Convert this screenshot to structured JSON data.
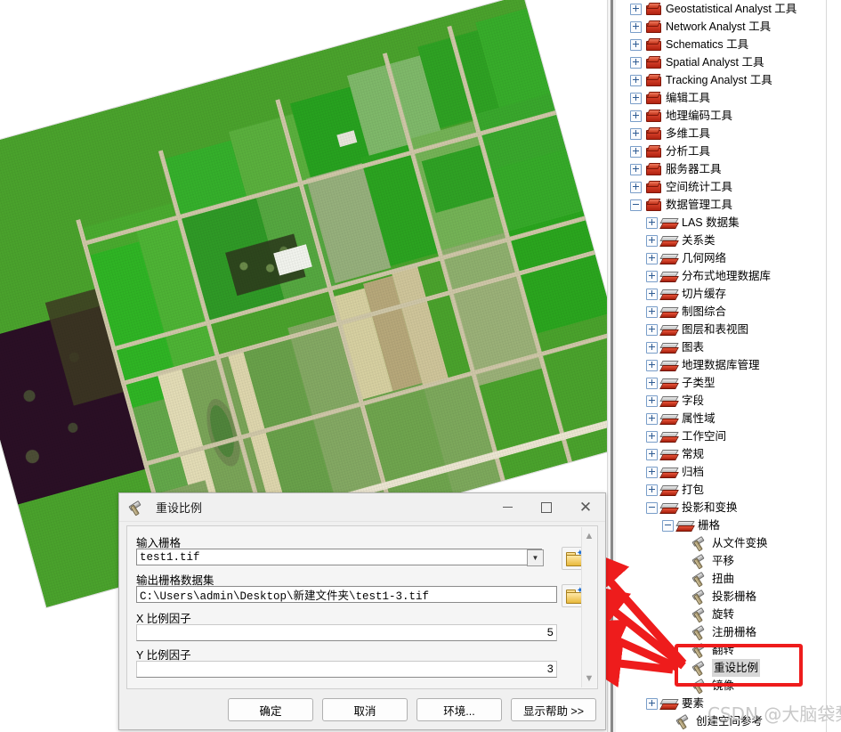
{
  "map": {
    "name": "aerial-raster-farmland",
    "rotation_deg": -15.5,
    "alt": "rotated aerial farmland raster"
  },
  "toolbox_tree": {
    "items": [
      {
        "label": "Geostatistical Analyst 工具",
        "level": 0,
        "icon": "toolbox-icon",
        "expander": "plus"
      },
      {
        "label": "Network Analyst 工具",
        "level": 0,
        "icon": "toolbox-icon",
        "expander": "plus"
      },
      {
        "label": "Schematics 工具",
        "level": 0,
        "icon": "toolbox-icon",
        "expander": "plus"
      },
      {
        "label": "Spatial Analyst 工具",
        "level": 0,
        "icon": "toolbox-icon",
        "expander": "plus"
      },
      {
        "label": "Tracking Analyst 工具",
        "level": 0,
        "icon": "toolbox-icon",
        "expander": "plus"
      },
      {
        "label": "编辑工具",
        "level": 0,
        "icon": "toolbox-icon",
        "expander": "plus"
      },
      {
        "label": "地理编码工具",
        "level": 0,
        "icon": "toolbox-icon",
        "expander": "plus"
      },
      {
        "label": "多维工具",
        "level": 0,
        "icon": "toolbox-icon",
        "expander": "plus"
      },
      {
        "label": "分析工具",
        "level": 0,
        "icon": "toolbox-icon",
        "expander": "plus"
      },
      {
        "label": "服务器工具",
        "level": 0,
        "icon": "toolbox-icon",
        "expander": "plus"
      },
      {
        "label": "空间统计工具",
        "level": 0,
        "icon": "toolbox-icon",
        "expander": "plus"
      },
      {
        "label": "数据管理工具",
        "level": 0,
        "icon": "toolbox-icon",
        "expander": "minus"
      },
      {
        "label": "LAS 数据集",
        "level": 1,
        "icon": "toolset-icon",
        "expander": "plus"
      },
      {
        "label": "关系类",
        "level": 1,
        "icon": "toolset-icon",
        "expander": "plus"
      },
      {
        "label": "几何网络",
        "level": 1,
        "icon": "toolset-icon",
        "expander": "plus"
      },
      {
        "label": "分布式地理数据库",
        "level": 1,
        "icon": "toolset-icon",
        "expander": "plus"
      },
      {
        "label": "切片缓存",
        "level": 1,
        "icon": "toolset-icon",
        "expander": "plus"
      },
      {
        "label": "制图综合",
        "level": 1,
        "icon": "toolset-icon",
        "expander": "plus"
      },
      {
        "label": "图层和表视图",
        "level": 1,
        "icon": "toolset-icon",
        "expander": "plus"
      },
      {
        "label": "图表",
        "level": 1,
        "icon": "toolset-icon",
        "expander": "plus"
      },
      {
        "label": "地理数据库管理",
        "level": 1,
        "icon": "toolset-icon",
        "expander": "plus"
      },
      {
        "label": "子类型",
        "level": 1,
        "icon": "toolset-icon",
        "expander": "plus"
      },
      {
        "label": "字段",
        "level": 1,
        "icon": "toolset-icon",
        "expander": "plus"
      },
      {
        "label": "属性域",
        "level": 1,
        "icon": "toolset-icon",
        "expander": "plus"
      },
      {
        "label": "工作空间",
        "level": 1,
        "icon": "toolset-icon",
        "expander": "plus"
      },
      {
        "label": "常规",
        "level": 1,
        "icon": "toolset-icon",
        "expander": "plus"
      },
      {
        "label": "归档",
        "level": 1,
        "icon": "toolset-icon",
        "expander": "plus"
      },
      {
        "label": "打包",
        "level": 1,
        "icon": "toolset-icon",
        "expander": "plus"
      },
      {
        "label": "投影和变换",
        "level": 1,
        "icon": "toolset-icon",
        "expander": "minus"
      },
      {
        "label": "栅格",
        "level": 2,
        "icon": "toolset-icon",
        "expander": "minus"
      },
      {
        "label": "从文件变换",
        "level": 3,
        "icon": "hammer-icon",
        "expander": "none"
      },
      {
        "label": "平移",
        "level": 3,
        "icon": "hammer-icon",
        "expander": "none"
      },
      {
        "label": "扭曲",
        "level": 3,
        "icon": "hammer-icon",
        "expander": "none"
      },
      {
        "label": "投影栅格",
        "level": 3,
        "icon": "hammer-icon",
        "expander": "none"
      },
      {
        "label": "旋转",
        "level": 3,
        "icon": "hammer-icon",
        "expander": "none"
      },
      {
        "label": "注册栅格",
        "level": 3,
        "icon": "hammer-icon",
        "expander": "none"
      },
      {
        "label": "翻转",
        "level": 3,
        "icon": "hammer-icon",
        "expander": "none"
      },
      {
        "label": "重设比例",
        "level": 3,
        "icon": "hammer-icon",
        "expander": "none",
        "selected": true
      },
      {
        "label": "镜像",
        "level": 3,
        "icon": "hammer-icon",
        "expander": "none"
      },
      {
        "label": "要素",
        "level": 1,
        "icon": "toolset-icon",
        "expander": "plus"
      },
      {
        "label": "创建空间参考",
        "level": 2,
        "icon": "hammer-icon",
        "expander": "none"
      }
    ],
    "highlight_color": "#ee1c1c"
  },
  "dialog": {
    "title": "重设比例",
    "title_icon": "hammer-icon",
    "window_buttons": {
      "minimize": "minimize-icon",
      "maximize": "maximize-icon",
      "close": "close-icon"
    },
    "fields": [
      {
        "label": "输入栅格",
        "value": "test1.tif",
        "control": "combobox",
        "browse_icon": "open-folder-icon"
      },
      {
        "label": "输出栅格数据集",
        "value": "C:\\Users\\admin\\Desktop\\新建文件夹\\test1-3.tif",
        "control": "textbox",
        "browse_icon": "open-folder-icon"
      },
      {
        "label": "X 比例因子",
        "value": "5",
        "control": "numberbox"
      },
      {
        "label": "Y 比例因子",
        "value": "3",
        "control": "numberbox"
      }
    ],
    "buttons": [
      {
        "label": "确定",
        "name": "ok-button"
      },
      {
        "label": "取消",
        "name": "cancel-button"
      },
      {
        "label": "环境...",
        "name": "environments-button"
      },
      {
        "label": "显示帮助 >>",
        "name": "show-help-button"
      }
    ],
    "scroll_up_icon": "chevron-up-icon",
    "scroll_down_icon": "chevron-down-icon"
  },
  "annotations": {
    "arrow_color": "#ee1c1c",
    "arrow_count": 4,
    "box_target": "重设比例"
  },
  "watermark": {
    "text": "CSDN @大脑袋梨"
  }
}
